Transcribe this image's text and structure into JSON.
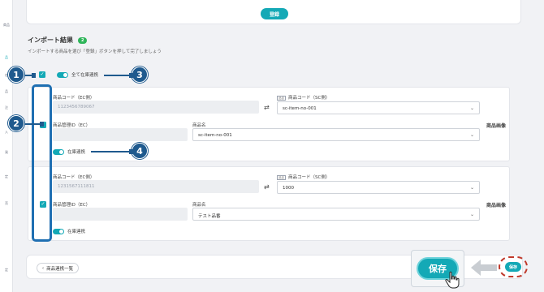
{
  "sidebar": {
    "items": [
      "商品",
      "品",
      "在",
      "品",
      "注",
      "入",
      "発",
      "定",
      "売",
      "定"
    ]
  },
  "top": {
    "register_label": "登録"
  },
  "import": {
    "title": "インポート結果",
    "count": "2",
    "description": "インポートする商品を選び「登録」ボタンを押して完了しましょう",
    "all_sync_label": "全て在庫連携"
  },
  "items": [
    {
      "ec_code_label": "商品コード（EC側）",
      "ec_code_value": "1123456789067",
      "sc_code_tag": "品目",
      "sc_code_label": "商品コード（SC側）",
      "sc_code_value": "sc-item-no-001",
      "ec_manage_label": "商品管理ID（EC）",
      "ec_manage_value": "",
      "product_name_label": "商品名",
      "product_name_value": "sc-item-no-001",
      "image_label": "商品画像",
      "sync_label": "在庫連携"
    },
    {
      "ec_code_label": "商品コード（EC側）",
      "ec_code_value": "1231567111811",
      "sc_code_tag": "品目",
      "sc_code_label": "商品コード（SC側）",
      "sc_code_value": "1000",
      "ec_manage_label": "商品管理ID（EC）",
      "ec_manage_value": "",
      "product_name_label": "商品名",
      "product_name_value": "テスト品番",
      "image_label": "商品画像",
      "sync_label": "在庫連携"
    }
  ],
  "bottom": {
    "back_label": "商品連携一覧",
    "save_label": "保存",
    "save_small_label": "保存"
  },
  "callouts": [
    "1",
    "2",
    "3",
    "4"
  ],
  "colors": {
    "accent": "#14a9b6",
    "callout": "#1f5a8e",
    "highlight": "#c0392b"
  }
}
